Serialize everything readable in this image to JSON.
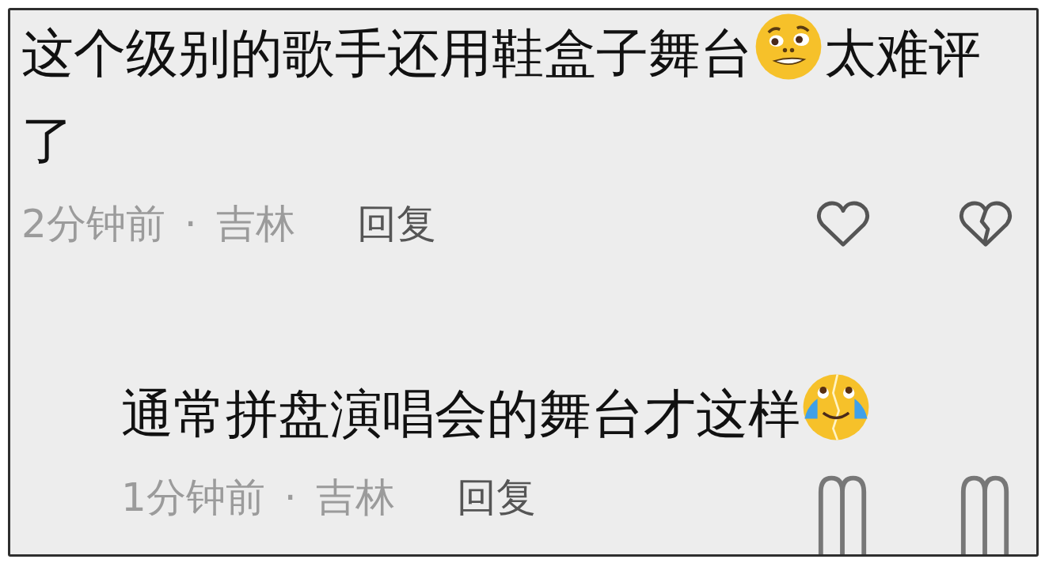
{
  "comments": [
    {
      "text": "这个级别的歌手还用鞋盒子舞台",
      "emoji": {
        "kind": "worried"
      },
      "text_after": "太难评了",
      "time": "2分钟前",
      "separator": "·",
      "location": "吉林",
      "reply_label": "回复",
      "reply": false,
      "icons": {
        "kind": "outline"
      }
    },
    {
      "text": "通常拼盘演唱会的舞台才这样",
      "emoji": {
        "kind": "crying"
      },
      "time": "1分钟前",
      "separator": "·",
      "location": "吉林",
      "reply_label": "回复",
      "reply": true,
      "icons": {
        "kind": "streaked"
      }
    }
  ]
}
